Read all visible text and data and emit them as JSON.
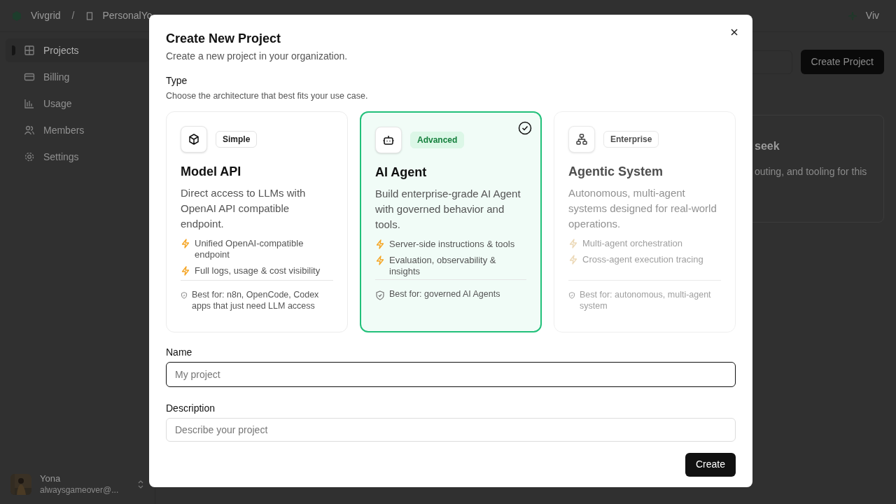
{
  "topbar": {
    "brand": "Vivgrid",
    "separator": "/",
    "org": "PersonalYo",
    "user": "Viv"
  },
  "sidebar": {
    "items": [
      {
        "label": "Projects",
        "selected": true
      },
      {
        "label": "Billing",
        "selected": false
      },
      {
        "label": "Usage",
        "selected": false
      },
      {
        "label": "Members",
        "selected": false
      },
      {
        "label": "Settings",
        "selected": false
      }
    ],
    "account": {
      "name": "Yona",
      "email": "alwaysgameover@..."
    }
  },
  "main": {
    "create_button": "Create Project",
    "card_title": "seek",
    "card_text": "outing, and tooling for this"
  },
  "dialog": {
    "title": "Create New Project",
    "subtitle": "Create a new project in your organization.",
    "type_label": "Type",
    "type_hint": "Choose the architecture that best fits your use case.",
    "options": [
      {
        "badge": "Simple",
        "title": "Model API",
        "description": "Direct access to LLMs with OpenAI API compatible endpoint.",
        "features": [
          "Unified OpenAI-compatible endpoint",
          "Full logs, usage & cost visibility"
        ],
        "best_for": "Best for: n8n, OpenCode, Codex apps that just need LLM access",
        "selected": false,
        "disabled": false
      },
      {
        "badge": "Advanced",
        "title": "AI Agent",
        "description": "Build enterprise-grade AI Agent with governed behavior and tools.",
        "features": [
          "Server-side instructions & tools",
          "Evaluation, observability & insights"
        ],
        "best_for": "Best for: governed AI Agents",
        "selected": true,
        "disabled": false
      },
      {
        "badge": "Enterprise",
        "title": "Agentic System",
        "description": "Autonomous, multi-agent systems designed for real-world operations.",
        "features": [
          "Multi-agent orchestration",
          "Cross-agent execution tracing"
        ],
        "best_for": "Best for: autonomous, multi-agent system",
        "selected": false,
        "disabled": true
      }
    ],
    "name_label": "Name",
    "name_placeholder": "My project",
    "description_label": "Description",
    "description_placeholder": "Describe your project",
    "create_button": "Create"
  }
}
